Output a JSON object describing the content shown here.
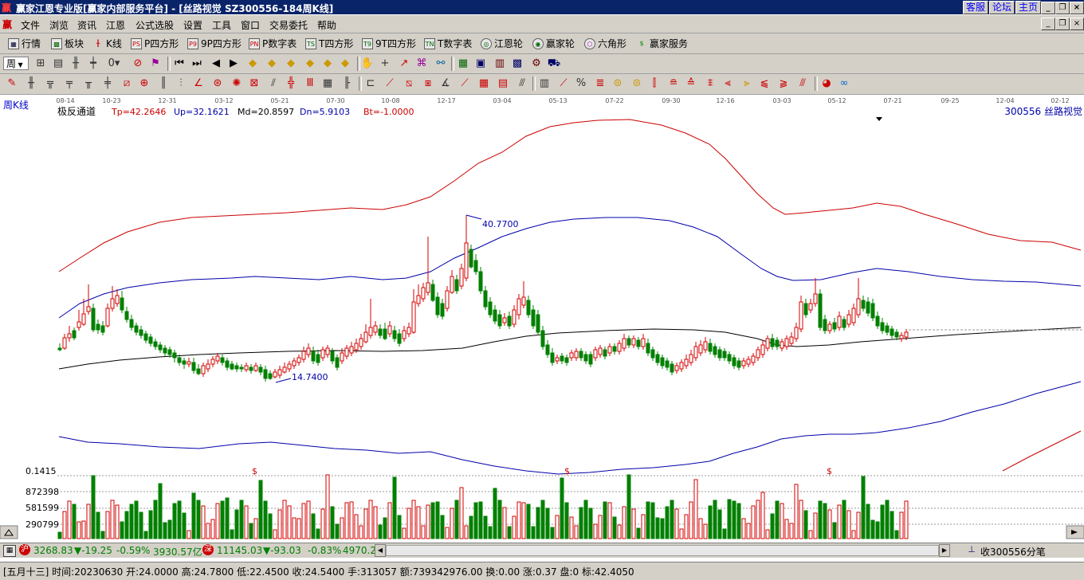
{
  "window": {
    "title": "赢家江恩专业版[赢家内部服务平台] - [丝路视觉  SZ300556-184周K线]",
    "right_buttons": [
      "客服",
      "论坛",
      "主页"
    ]
  },
  "menu": {
    "logo": "赢",
    "items": [
      "文件",
      "浏览",
      "资讯",
      "江恩",
      "公式选股",
      "设置",
      "工具",
      "窗口",
      "交易委托",
      "帮助"
    ]
  },
  "toolbar1": {
    "items": [
      {
        "label": "行情",
        "icon": "grid-icon"
      },
      {
        "label": "板块",
        "icon": "blocks-icon"
      },
      {
        "label": "K线",
        "icon": "kline-icon"
      },
      {
        "label": "P四方形",
        "icon": "ps-icon",
        "tag": "PS"
      },
      {
        "label": "9P四方形",
        "icon": "p9-icon",
        "tag": "P9"
      },
      {
        "label": "P数字表",
        "icon": "pn-icon",
        "tag": "PN"
      },
      {
        "label": "T四方形",
        "icon": "ts-icon",
        "tag": "TS"
      },
      {
        "label": "9T四方形",
        "icon": "t9-icon",
        "tag": "T9"
      },
      {
        "label": "T数字表",
        "icon": "tn-icon",
        "tag": "TN"
      },
      {
        "label": "江恩轮",
        "icon": "gann-wheel-icon"
      },
      {
        "label": "赢家轮",
        "icon": "winner-wheel-icon"
      },
      {
        "label": "六角形",
        "icon": "hexagon-icon"
      },
      {
        "label": "赢家服务",
        "icon": "dollar-icon"
      }
    ]
  },
  "toolbar2": {
    "period_label": "周"
  },
  "chart_header": {
    "period": "周K线",
    "indicator": "极反通道",
    "tp": "Tp=42.2646",
    "up": "Up=32.1621",
    "md": "Md=20.8597",
    "dn": "Dn=5.9103",
    "bt": "Bt=-1.0000",
    "stock": "300556  丝路视觉"
  },
  "chart_data": {
    "type": "candlestick",
    "x_tick_labels": [
      "08-14",
      "10-23",
      "12-31",
      "03-12",
      "05-21",
      "07-30",
      "10-08",
      "12-17",
      "03-04",
      "05-13",
      "07-22",
      "09-30",
      "12-16",
      "03-03",
      "05-12",
      "07-21",
      "09-25",
      "12-04",
      "02-12"
    ],
    "annotations": {
      "high": "40.7700",
      "low": "14.7400"
    },
    "volume_axis_labels": [
      "0.1415",
      "872398",
      "581599",
      "290799"
    ],
    "volume_markers": [
      "$",
      "$",
      "$"
    ],
    "colors": {
      "up": "#d40000",
      "down": "#008000",
      "upper_band": "#cc0000",
      "mid_band": "#0000aa",
      "md_line": "#000000"
    }
  },
  "market": {
    "sh_tag": "沪",
    "sh_index": "3268.83",
    "sh_change": "▼-19.25",
    "sh_pct": "-0.59%",
    "sh_amount": "3930.57亿",
    "sz_tag": "深",
    "sz_index": "11145.03",
    "sz_change": "▼-93.03",
    "sz_pct": "-0.83%",
    "sz_amount": "4970.2",
    "right_text": "收300556分笔"
  },
  "status": {
    "text": "[五月十三] 时间:20230630 开:24.0000 高:24.7800 低:22.4500 收:24.5400 手:313057 额:739342976.00 换:0.00 涨:0.37 盘:0 标:42.4050"
  }
}
